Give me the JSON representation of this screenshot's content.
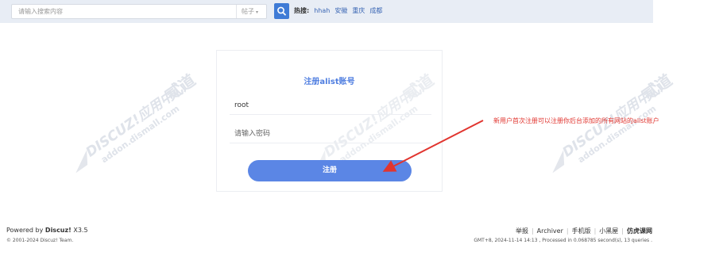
{
  "search": {
    "placeholder": "请输入搜索内容",
    "type_label": "帖子",
    "hot_label": "热搜:",
    "hot_items": [
      "hhah",
      "安徽",
      "重庆",
      "成都"
    ]
  },
  "register": {
    "title": "注册alist账号",
    "username_value": "root",
    "password_placeholder": "请输入密码",
    "submit_label": "注册"
  },
  "annotation": {
    "text": "新用户首次注册可以注册你后台添加的所有网站的alist账户"
  },
  "watermark": {
    "line1": "DISCUZ!应用中心",
    "line2": "addon.dismall.com",
    "brand": "贰道"
  },
  "footer": {
    "powered_prefix": "Powered by ",
    "powered_brand": "Discuz!",
    "powered_version": " X3.5",
    "copyright": "© 2001-2024 Discuz! Team.",
    "links": [
      "举报",
      "Archiver",
      "手机版",
      "小黑屋",
      "仿虎课网"
    ],
    "stats": "GMT+8, 2024-11-14 14:13 , Processed in 0.068785 second(s), 13 queries ."
  },
  "colors": {
    "accent": "#5b86e5",
    "annotation": "#e1352f",
    "topbar": "#e8edf5"
  }
}
